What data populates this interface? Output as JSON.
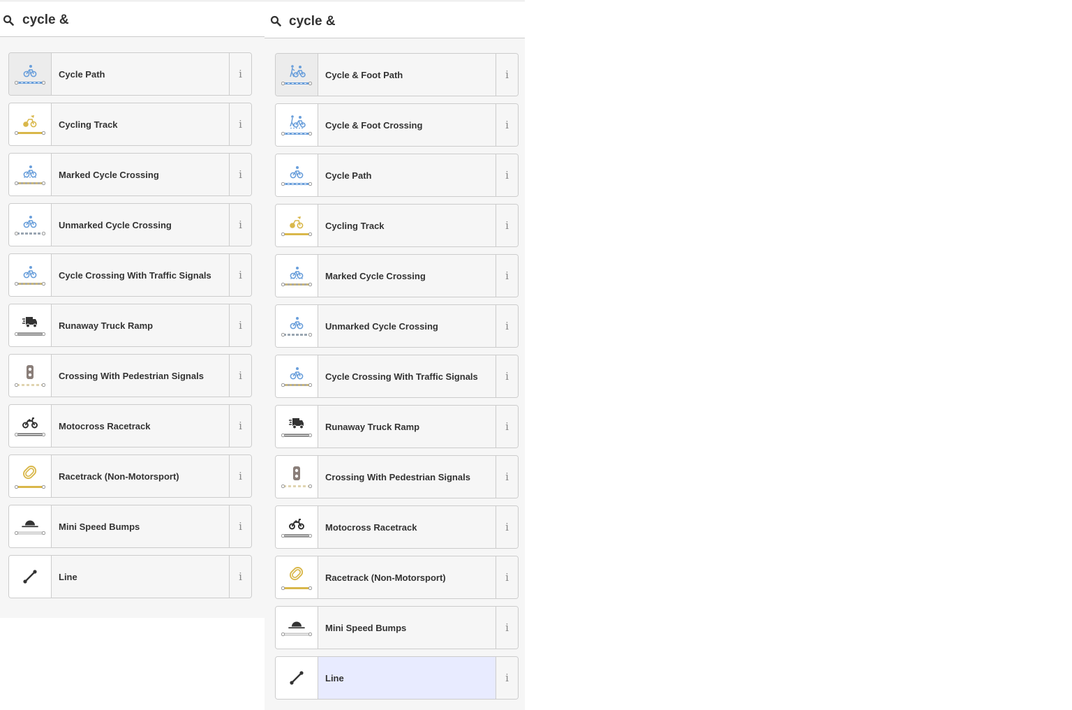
{
  "panels": [
    {
      "id": "left",
      "search": {
        "value": "cycle &"
      },
      "presets": [
        {
          "label": "Cycle Path",
          "icon": "bicycle-icon",
          "line": "blue-dash",
          "state": "hovered"
        },
        {
          "label": "Cycling Track",
          "icon": "cycling-track-icon",
          "line": "yellow",
          "state": ""
        },
        {
          "label": "Marked Cycle Crossing",
          "icon": "cycle-crossing-icon",
          "line": "gray-dash",
          "state": ""
        },
        {
          "label": "Unmarked Cycle Crossing",
          "icon": "bicycle-icon",
          "line": "gray-blue-dash",
          "state": ""
        },
        {
          "label": "Cycle Crossing With Traffic Signals",
          "icon": "bicycle-icon",
          "line": "gray-dash",
          "state": ""
        },
        {
          "label": "Runaway Truck Ramp",
          "icon": "truck-icon",
          "line": "double",
          "state": ""
        },
        {
          "label": "Crossing With Pedestrian Signals",
          "icon": "traffic-signal-icon",
          "line": "tan-dash",
          "state": ""
        },
        {
          "label": "Motocross Racetrack",
          "icon": "motorcycle-icon",
          "line": "double",
          "state": ""
        },
        {
          "label": "Racetrack (Non-Motorsport)",
          "icon": "racetrack-icon",
          "line": "yellow",
          "state": ""
        },
        {
          "label": "Mini Speed Bumps",
          "icon": "speed-bump-icon",
          "line": "white",
          "state": ""
        },
        {
          "label": "Line",
          "icon": "line-icon",
          "line": "none",
          "state": ""
        }
      ]
    },
    {
      "id": "right",
      "search": {
        "value": "cycle &"
      },
      "presets": [
        {
          "label": "Cycle & Foot Path",
          "icon": "cycle-foot-icon",
          "line": "blue-dash",
          "state": "hovered"
        },
        {
          "label": "Cycle & Foot Crossing",
          "icon": "cycle-foot-crossing-icon",
          "line": "blue-dash",
          "state": ""
        },
        {
          "label": "Cycle Path",
          "icon": "bicycle-icon",
          "line": "blue-dash",
          "state": ""
        },
        {
          "label": "Cycling Track",
          "icon": "cycling-track-icon",
          "line": "yellow",
          "state": ""
        },
        {
          "label": "Marked Cycle Crossing",
          "icon": "cycle-crossing-icon",
          "line": "gray-dash",
          "state": ""
        },
        {
          "label": "Unmarked Cycle Crossing",
          "icon": "bicycle-icon",
          "line": "gray-blue-dash",
          "state": ""
        },
        {
          "label": "Cycle Crossing With Traffic Signals",
          "icon": "bicycle-icon",
          "line": "gray-dash",
          "state": ""
        },
        {
          "label": "Runaway Truck Ramp",
          "icon": "truck-icon",
          "line": "double",
          "state": ""
        },
        {
          "label": "Crossing With Pedestrian Signals",
          "icon": "traffic-signal-icon",
          "line": "tan-dash",
          "state": ""
        },
        {
          "label": "Motocross Racetrack",
          "icon": "motorcycle-icon",
          "line": "double",
          "state": ""
        },
        {
          "label": "Racetrack (Non-Motorsport)",
          "icon": "racetrack-icon",
          "line": "yellow",
          "state": ""
        },
        {
          "label": "Mini Speed Bumps",
          "icon": "speed-bump-icon",
          "line": "white",
          "state": ""
        },
        {
          "label": "Line",
          "icon": "line-icon",
          "line": "none",
          "state": "selected"
        }
      ]
    }
  ],
  "info_glyph": "i",
  "colors": {
    "cycle_blue": "#6a9fdb",
    "track_yellow": "#d9b74a",
    "dark_icon": "#333333",
    "signal_gray": "#8a7e79",
    "selected_bg": "#e8ebff",
    "border": "#cccccc"
  }
}
